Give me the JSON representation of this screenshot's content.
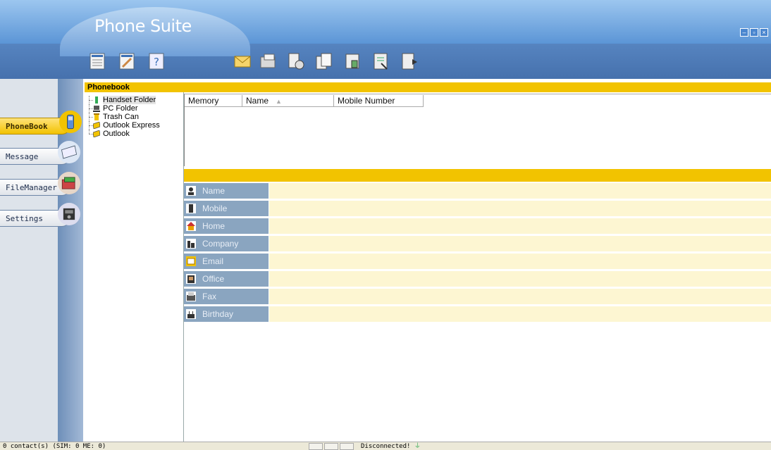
{
  "app": {
    "title": "Phone Suite"
  },
  "window_controls": [
    "minimize-icon",
    "restore-icon",
    "close-icon"
  ],
  "toolbar_left": [
    "contacts-list-icon",
    "edit-icon",
    "help-icon"
  ],
  "toolbar_right": [
    "envelope-icon",
    "folder-icon",
    "sync-icon",
    "copy-icon",
    "phone-data-icon",
    "delete-icon",
    "export-icon"
  ],
  "nav": [
    {
      "label": "PhoneBook",
      "active": true,
      "icon": "phone-icon"
    },
    {
      "label": "Message",
      "active": false,
      "icon": "envelope-icon"
    },
    {
      "label": "FileManager",
      "active": false,
      "icon": "folder-icon"
    },
    {
      "label": "Settings",
      "active": false,
      "icon": "settings-icon"
    }
  ],
  "tree": {
    "header": "Phonebook",
    "items": [
      {
        "label": "Handset Folder",
        "icon": "handset-icon",
        "selected": true
      },
      {
        "label": "PC Folder",
        "icon": "pc-icon",
        "selected": false
      },
      {
        "label": "Trash Can",
        "icon": "trash-icon",
        "selected": false
      },
      {
        "label": "Outlook Express",
        "icon": "outlook-express-icon",
        "selected": false
      },
      {
        "label": "Outlook",
        "icon": "outlook-icon",
        "selected": false
      }
    ]
  },
  "list": {
    "columns": [
      "Memory",
      "Name",
      "Mobile Number"
    ],
    "sort_indicator": "▲"
  },
  "fields": [
    {
      "label": "Name",
      "icon": "contact-card-icon"
    },
    {
      "label": "Mobile",
      "icon": "mobile-icon"
    },
    {
      "label": "Home",
      "icon": "home-icon"
    },
    {
      "label": "Company",
      "icon": "company-icon"
    },
    {
      "label": "Email",
      "icon": "email-icon"
    },
    {
      "label": "Office",
      "icon": "office-icon"
    },
    {
      "label": "Fax",
      "icon": "fax-icon"
    },
    {
      "label": "Birthday",
      "icon": "birthday-icon"
    }
  ],
  "status": {
    "left": "0 contact(s) (SIM: 0  ME: 0)",
    "connection": "Disconnected!"
  },
  "colors": {
    "accent": "#f2c300",
    "header": "#4f7ebd",
    "field_label": "#8aa5c0",
    "field_value": "#fdf6d2"
  }
}
